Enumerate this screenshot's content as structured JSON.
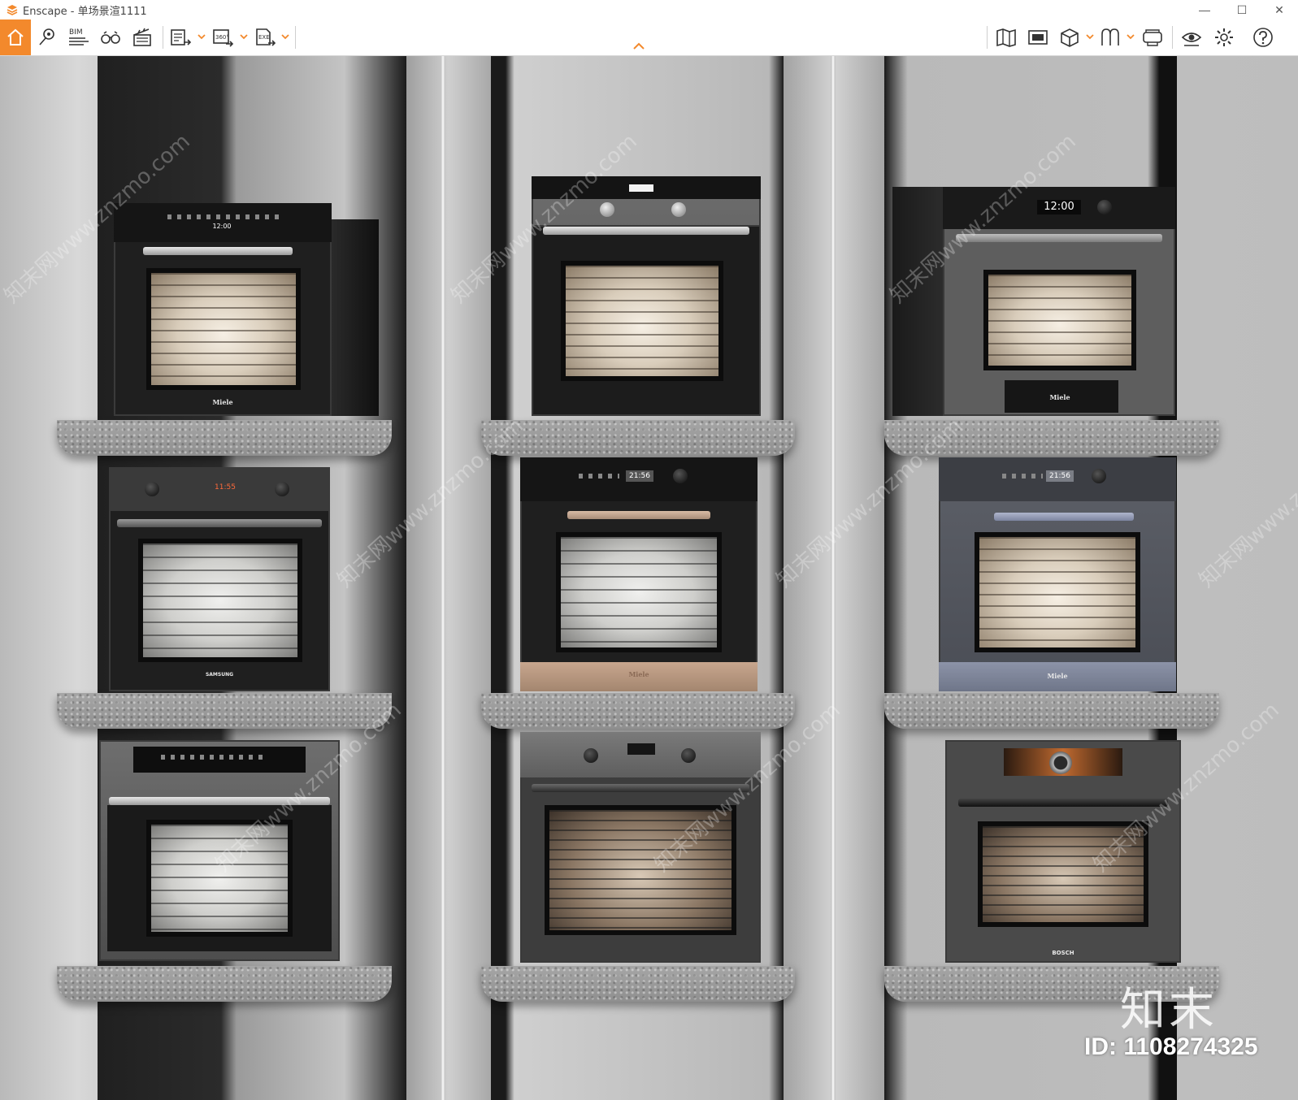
{
  "window": {
    "app_name": "Enscape",
    "title_separator": " - ",
    "document_name": "单场景渲1111",
    "controls": {
      "minimize": "—",
      "maximize": "☐",
      "close": "✕"
    }
  },
  "toolbar": {
    "left_icons": [
      "home-icon",
      "location-pin-icon",
      "bim-icon",
      "binoculars-icon",
      "clapperboard-icon",
      "screenshot-export-icon",
      "panorama-360-icon",
      "exe-export-icon"
    ],
    "bim_label": "BIM",
    "panorama_label": "360°",
    "exe_label": "EXE",
    "right_icons": [
      "map-icon",
      "camera-view-icon",
      "cube-icon",
      "material-icon",
      "vr-headset-icon",
      "eye-icon",
      "settings-icon",
      "help-icon"
    ],
    "accent_color": "#f3892c"
  },
  "scene": {
    "ovens": [
      {
        "id": "top-left",
        "display": "12:00",
        "brand": "Miele"
      },
      {
        "id": "top-center",
        "display": "",
        "brand": ""
      },
      {
        "id": "top-right",
        "display": "12:00",
        "brand": "Miele"
      },
      {
        "id": "middle-left",
        "display": "11:55",
        "brand": "SAMSUNG"
      },
      {
        "id": "middle-center",
        "display": "21:56",
        "brand": "Miele"
      },
      {
        "id": "middle-right",
        "display": "21:56",
        "brand": "Miele"
      },
      {
        "id": "bottom-left",
        "display": "",
        "brand": ""
      },
      {
        "id": "bottom-center",
        "display": "",
        "brand": ""
      },
      {
        "id": "bottom-right",
        "display": "",
        "brand": "BOSCH"
      }
    ]
  },
  "overlay": {
    "watermark_text": "知末网www.znzmo.com",
    "logo_text": "知末",
    "id_label": "ID: 1108274325"
  }
}
